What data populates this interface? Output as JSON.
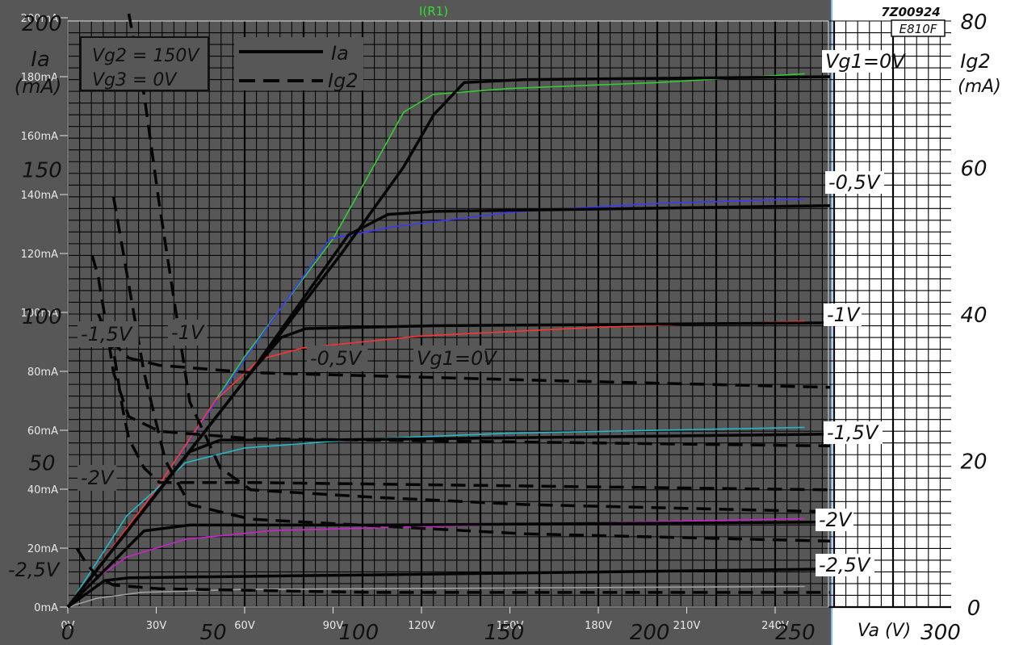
{
  "chart_data": {
    "type": "line",
    "title": "I(R1)",
    "sheet_id": "7Z00924",
    "tube": "E810F",
    "conditions": [
      "Vg2 = 150V",
      "Vg3 = 0V"
    ],
    "legend": [
      {
        "label": "Ia",
        "style": "solid"
      },
      {
        "label": "Ig2",
        "style": "dashed"
      }
    ],
    "axes": {
      "sim_x_ticks": [
        "0V",
        "30V",
        "60V",
        "90V",
        "120V",
        "150V",
        "180V",
        "210V",
        "240V"
      ],
      "sim_y_ticks": [
        "0mA",
        "20mA",
        "40mA",
        "60mA",
        "80mA",
        "100mA",
        "120mA",
        "140mA",
        "160mA",
        "180mA",
        "200mA"
      ],
      "sim_xlim": [
        0,
        250
      ],
      "sim_ylim": [
        0,
        200
      ],
      "sheet_x_ticks": [
        "0",
        "50",
        "100",
        "150",
        "200",
        "250",
        "300"
      ],
      "sheet_xlabel": "Va (V)",
      "sheet_ia_ticks": [
        "50",
        "100",
        "150",
        "200"
      ],
      "sheet_ia_label": [
        "Ia",
        "(mA)"
      ],
      "sheet_ig2_ticks": [
        "0",
        "20",
        "40",
        "60",
        "80"
      ],
      "sheet_ig2_label": [
        "Ig2",
        "(mA)"
      ],
      "sheet_xlim": [
        0,
        300
      ],
      "sheet_ylim": [
        0,
        200
      ],
      "ig2_lim": [
        0,
        80
      ]
    },
    "ia_curve_labels": [
      "Vg1=0V",
      "-0,5V",
      "-1V",
      "-1,5V",
      "-2V",
      "-2,5V"
    ],
    "ig2_curve_labels": [
      "-1,5V",
      "-1V",
      "-0,5V",
      "Vg1=0V",
      "-2V",
      "-2,5V"
    ],
    "series": [
      {
        "name": "",
        "role": "sim",
        "color": "#33cc33",
        "points": [
          [
            0,
            0
          ],
          [
            30,
            40
          ],
          [
            60,
            85
          ],
          [
            90,
            125
          ],
          [
            114,
            168
          ],
          [
            124,
            174
          ],
          [
            150,
            176
          ],
          [
            200,
            178
          ],
          [
            250,
            181
          ]
        ]
      },
      {
        "name": "",
        "role": "sim",
        "color": "#3a3aff",
        "points": [
          [
            0,
            0
          ],
          [
            30,
            40
          ],
          [
            60,
            84
          ],
          [
            89,
            125
          ],
          [
            110,
            129
          ],
          [
            150,
            134
          ],
          [
            200,
            137
          ],
          [
            250,
            138.5
          ]
        ]
      },
      {
        "name": "",
        "role": "sim",
        "color": "#ff3333",
        "points": [
          [
            0,
            0
          ],
          [
            30,
            40
          ],
          [
            50,
            70
          ],
          [
            65,
            84
          ],
          [
            80,
            88
          ],
          [
            120,
            92
          ],
          [
            180,
            95
          ],
          [
            250,
            97
          ]
        ]
      },
      {
        "name": "",
        "role": "sim",
        "color": "#22b8c8",
        "points": [
          [
            0,
            0
          ],
          [
            20,
            31
          ],
          [
            40,
            49
          ],
          [
            60,
            54
          ],
          [
            100,
            57
          ],
          [
            150,
            59
          ],
          [
            250,
            61
          ]
        ]
      },
      {
        "name": "",
        "role": "sim",
        "color": "#cc22cc",
        "points": [
          [
            0,
            0
          ],
          [
            10,
            10
          ],
          [
            20,
            17
          ],
          [
            40,
            23
          ],
          [
            70,
            26
          ],
          [
            150,
            28
          ],
          [
            250,
            30
          ]
        ]
      },
      {
        "name": "",
        "role": "sim",
        "color": "#a0a0a0",
        "points": [
          [
            0,
            0
          ],
          [
            10,
            3
          ],
          [
            25,
            5
          ],
          [
            60,
            6
          ],
          [
            250,
            7
          ]
        ]
      },
      {
        "name": "",
        "role": "sheet-ia",
        "points": [
          [
            0,
            0
          ],
          [
            60,
            80
          ],
          [
            90,
            121
          ],
          [
            110,
            150
          ],
          [
            120,
            168
          ],
          [
            130,
            179
          ],
          [
            150,
            180
          ],
          [
            250,
            181
          ]
        ]
      },
      {
        "name": "",
        "role": "sheet-ia",
        "points": [
          [
            0,
            0
          ],
          [
            60,
            80
          ],
          [
            92,
            127
          ],
          [
            105,
            134
          ],
          [
            120,
            135
          ],
          [
            250,
            137
          ]
        ]
      },
      {
        "name": "",
        "role": "sheet-ia",
        "points": [
          [
            0,
            0
          ],
          [
            60,
            80
          ],
          [
            70,
            92
          ],
          [
            78,
            95
          ],
          [
            120,
            96
          ],
          [
            250,
            97
          ]
        ]
      },
      {
        "name": "",
        "role": "sheet-ia",
        "points": [
          [
            0,
            0
          ],
          [
            40,
            53
          ],
          [
            50,
            57
          ],
          [
            80,
            57
          ],
          [
            250,
            59
          ]
        ]
      },
      {
        "name": "",
        "role": "sheet-ia",
        "points": [
          [
            0,
            0
          ],
          [
            25,
            26
          ],
          [
            40,
            28
          ],
          [
            100,
            28
          ],
          [
            250,
            29
          ]
        ]
      },
      {
        "name": "",
        "role": "sheet-ia",
        "points": [
          [
            0,
            0
          ],
          [
            12,
            9
          ],
          [
            20,
            10
          ],
          [
            100,
            11
          ],
          [
            250,
            13
          ]
        ]
      },
      {
        "name": "",
        "role": "sheet-ig2",
        "points": [
          [
            20,
            81
          ],
          [
            25,
            70
          ],
          [
            30,
            55
          ],
          [
            40,
            28
          ],
          [
            50,
            19
          ],
          [
            60,
            16
          ],
          [
            100,
            15
          ],
          [
            150,
            14
          ],
          [
            250,
            13
          ]
        ]
      },
      {
        "name": "",
        "role": "sheet-ig2",
        "points": [
          [
            15,
            56
          ],
          [
            20,
            44
          ],
          [
            25,
            32
          ],
          [
            32,
            20
          ],
          [
            40,
            14
          ],
          [
            60,
            12
          ],
          [
            150,
            10
          ],
          [
            250,
            9
          ]
        ]
      },
      {
        "name": "",
        "role": "sheet-ig2",
        "points": [
          [
            10,
            39
          ],
          [
            12,
            38
          ],
          [
            15,
            36
          ],
          [
            20,
            34
          ],
          [
            30,
            33
          ],
          [
            60,
            32
          ],
          [
            150,
            31
          ],
          [
            250,
            30
          ]
        ]
      },
      {
        "name": "",
        "role": "sheet-ig2",
        "points": [
          [
            10,
            40
          ],
          [
            15,
            35
          ],
          [
            18,
            27
          ],
          [
            20,
            23
          ],
          [
            25,
            19
          ],
          [
            30,
            17
          ],
          [
            60,
            17
          ],
          [
            250,
            16
          ]
        ]
      },
      {
        "name": "",
        "role": "sheet-ig2",
        "points": [
          [
            8,
            48
          ],
          [
            10,
            45
          ],
          [
            12,
            40
          ],
          [
            15,
            32
          ],
          [
            20,
            26
          ],
          [
            30,
            24
          ],
          [
            60,
            23
          ],
          [
            250,
            22
          ]
        ]
      },
      {
        "name": "",
        "role": "sheet-ig2",
        "points": [
          [
            3,
            8
          ],
          [
            6,
            6
          ],
          [
            10,
            4
          ],
          [
            15,
            3
          ],
          [
            30,
            2.5
          ],
          [
            100,
            2
          ],
          [
            250,
            2
          ]
        ]
      }
    ]
  }
}
